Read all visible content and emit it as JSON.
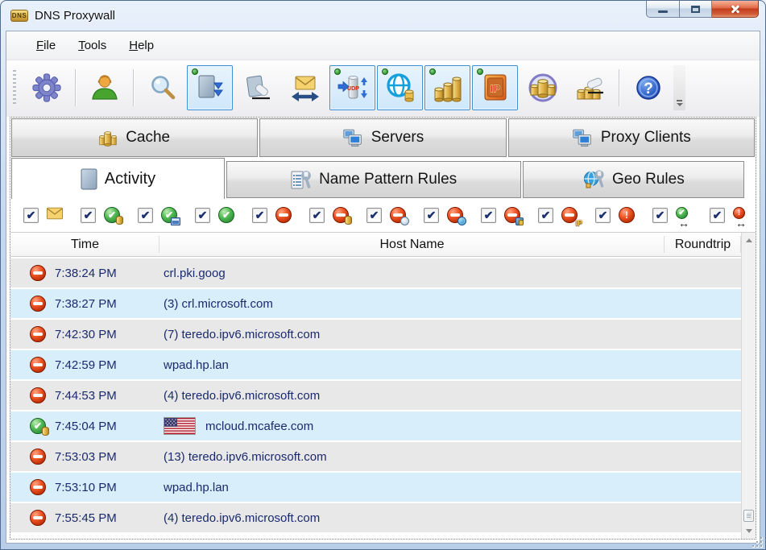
{
  "window": {
    "title": "DNS Proxywall"
  },
  "menu": {
    "items": [
      {
        "label": "File"
      },
      {
        "label": "Tools"
      },
      {
        "label": "Help"
      }
    ]
  },
  "glyphs": {
    "check": "✔",
    "exclaim": "!",
    "arrow": "↔",
    "ip": "IP",
    "udp": "UDP",
    "help": "?",
    "dns": "DNS"
  },
  "toolbar": {
    "buttons": [
      {
        "icon": "settings-gear",
        "active": false
      },
      {
        "icon": "user-profile",
        "active": false
      },
      {
        "icon": "search",
        "active": false
      },
      {
        "icon": "follow-log",
        "active": true
      },
      {
        "icon": "clear-log",
        "active": false
      },
      {
        "icon": "mail-transfer",
        "active": false
      },
      {
        "icon": "udp-listener",
        "active": true
      },
      {
        "icon": "web-dns-cache",
        "active": true
      },
      {
        "icon": "statistics",
        "active": true
      },
      {
        "icon": "ip-firewall",
        "active": true
      },
      {
        "icon": "database",
        "active": false
      },
      {
        "icon": "clear-database",
        "active": false
      },
      {
        "icon": "help",
        "active": false
      }
    ]
  },
  "tabs_primary": [
    {
      "label": "Cache"
    },
    {
      "label": "Servers"
    },
    {
      "label": "Proxy Clients"
    }
  ],
  "tabs_secondary": [
    {
      "label": "Activity",
      "active": true
    },
    {
      "label": "Name Pattern Rules",
      "active": false
    },
    {
      "label": "Geo Rules",
      "active": false
    }
  ],
  "filters": [
    {
      "name": "messages",
      "checked": true
    },
    {
      "name": "allowed-cached",
      "checked": true
    },
    {
      "name": "allowed-list",
      "checked": true
    },
    {
      "name": "allowed",
      "checked": true
    },
    {
      "name": "blocked",
      "checked": true
    },
    {
      "name": "blocked-cached",
      "checked": true
    },
    {
      "name": "blocked-expired",
      "checked": true
    },
    {
      "name": "blocked-geo",
      "checked": true
    },
    {
      "name": "blocked-proxy",
      "checked": true
    },
    {
      "name": "blocked-ip",
      "checked": true
    },
    {
      "name": "error",
      "checked": true
    },
    {
      "name": "roundtrip-ok",
      "checked": true
    },
    {
      "name": "roundtrip-slow",
      "checked": true
    }
  ],
  "table": {
    "columns": [
      "Time",
      "Host Name",
      "Roundtrip"
    ],
    "rows": [
      {
        "status": "blocked",
        "time": "7:38:24 PM",
        "host": "crl.pki.goog",
        "roundtrip": ""
      },
      {
        "status": "blocked",
        "time": "7:38:27 PM",
        "host": "(3) crl.microsoft.com",
        "roundtrip": ""
      },
      {
        "status": "blocked",
        "time": "7:42:30 PM",
        "host": "(7) teredo.ipv6.microsoft.com",
        "roundtrip": ""
      },
      {
        "status": "blocked",
        "time": "7:42:59 PM",
        "host": "wpad.hp.lan",
        "roundtrip": ""
      },
      {
        "status": "blocked",
        "time": "7:44:53 PM",
        "host": "(4) teredo.ipv6.microsoft.com",
        "roundtrip": ""
      },
      {
        "status": "allowed",
        "time": "7:45:04 PM",
        "host": "mcloud.mcafee.com",
        "flag": "us",
        "roundtrip": ""
      },
      {
        "status": "blocked",
        "time": "7:53:03 PM",
        "host": "(13) teredo.ipv6.microsoft.com",
        "roundtrip": ""
      },
      {
        "status": "blocked",
        "time": "7:53:10 PM",
        "host": "wpad.hp.lan",
        "roundtrip": ""
      },
      {
        "status": "blocked",
        "time": "7:55:45 PM",
        "host": "(4) teredo.ipv6.microsoft.com",
        "roundtrip": ""
      }
    ]
  },
  "colors": {
    "row_alt_gray": "#e8e8e8",
    "row_alt_blue": "#d9eefb",
    "row_text": "#1a2a6e",
    "active_tool_border": "#3d8fd6",
    "active_tool_fill": "#d9ecfc",
    "blocked_red": "#c13007",
    "allowed_green": "#2c9038",
    "close_button_red": "#c23c1b"
  }
}
